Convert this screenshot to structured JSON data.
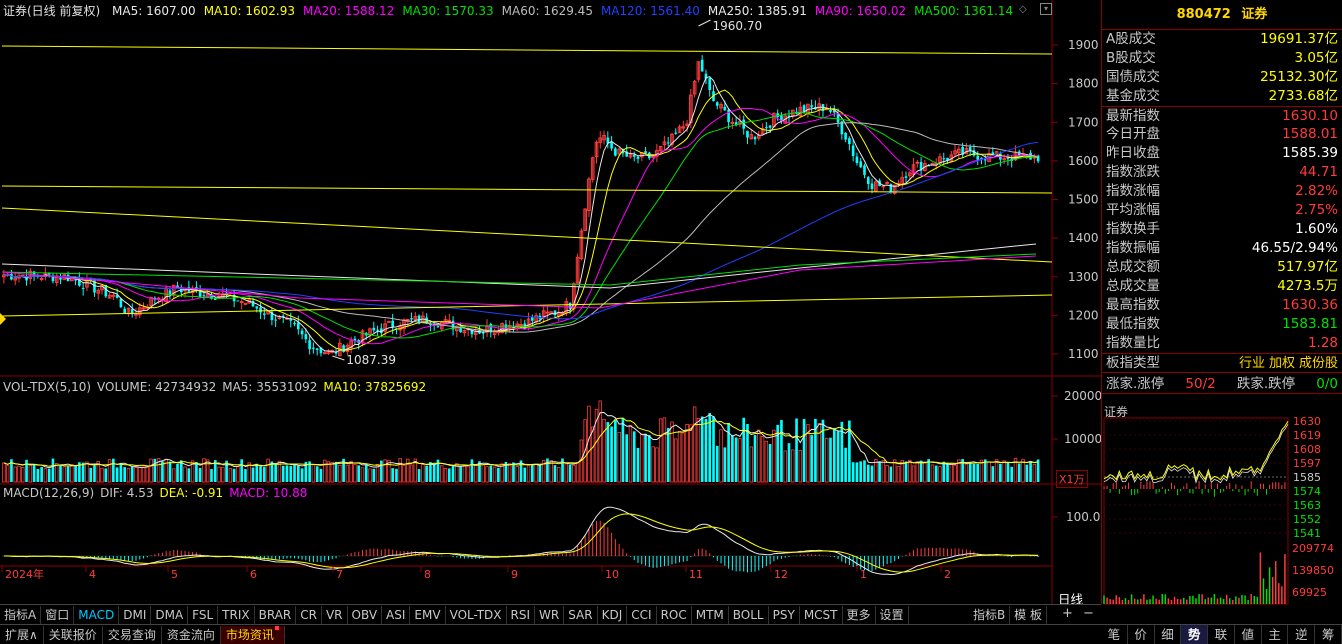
{
  "main_chart": {
    "title": "证券(日线 前复权)",
    "ma_legend": [
      {
        "label": "MA5: 1607.00",
        "color": "#e8e8e8"
      },
      {
        "label": "MA10: 1602.93",
        "color": "#ffff00"
      },
      {
        "label": "MA20: 1588.12",
        "color": "#ff00ff"
      },
      {
        "label": "MA30: 1570.33",
        "color": "#00e000"
      },
      {
        "label": "MA60: 1629.45",
        "color": "#bbbbbb"
      },
      {
        "label": "MA120: 1561.40",
        "color": "#2040ff"
      },
      {
        "label": "MA250: 1385.91",
        "color": "#e8e8e8"
      },
      {
        "label": "MA90: 1650.02",
        "color": "#ff00ff"
      },
      {
        "label": "MA500: 1361.14",
        "color": "#00e000"
      }
    ],
    "y_ticks": [
      "1900",
      "1800",
      "1700",
      "1600",
      "1500",
      "1400",
      "1300",
      "1200",
      "1100"
    ],
    "high_label": "1960.70",
    "low_label": "1087.39"
  },
  "volume_panel": {
    "legend": [
      {
        "label": "VOL-TDX(5,10)",
        "color": "#c8c8c8"
      },
      {
        "label": "VOLUME: 42734932",
        "color": "#c8c8c8"
      },
      {
        "label": "MA5: 35531092",
        "color": "#c8c8c8"
      },
      {
        "label": "MA10: 37825692",
        "color": "#ffff00"
      }
    ],
    "y_ticks": [
      "20000",
      "10000"
    ],
    "unit": "X1万"
  },
  "macd_panel": {
    "legend": [
      {
        "label": "MACD(12,26,9)",
        "color": "#c8c8c8"
      },
      {
        "label": "DIF: 4.53",
        "color": "#c8c8c8"
      },
      {
        "label": "DEA: -0.91",
        "color": "#ffff00"
      },
      {
        "label": "MACD: 10.88",
        "color": "#ff00ff"
      }
    ],
    "y_ticks": [
      "100.0"
    ]
  },
  "x_axis": [
    "2024年",
    "4",
    "5",
    "6",
    "7",
    "8",
    "9",
    "10",
    "11",
    "12",
    "1",
    "2"
  ],
  "info_panel": {
    "code": "880472",
    "name": "证券",
    "rows": [
      {
        "label": "A股成交",
        "value": "19691.37亿",
        "color": "yellow"
      },
      {
        "label": "B股成交",
        "value": "3.05亿",
        "color": "yellow"
      },
      {
        "label": "国债成交",
        "value": "25132.30亿",
        "color": "yellow"
      },
      {
        "label": "基金成交",
        "value": "2733.68亿",
        "color": "yellow"
      },
      {
        "label": "最新指数",
        "value": "1630.10",
        "color": "red"
      },
      {
        "label": "今日开盘",
        "value": "1588.01",
        "color": "red"
      },
      {
        "label": "昨日收盘",
        "value": "1585.39",
        "color": "white"
      },
      {
        "label": "指数涨跌",
        "value": "44.71",
        "color": "red"
      },
      {
        "label": "指数涨幅",
        "value": "2.82%",
        "color": "red"
      },
      {
        "label": "平均涨幅",
        "value": "2.75%",
        "color": "red"
      },
      {
        "label": "指数换手",
        "value": "1.60%",
        "color": "white"
      },
      {
        "label": "指数振幅",
        "value": "46.55/2.94%",
        "color": "white"
      },
      {
        "label": "总成交额",
        "value": "517.97亿",
        "color": "yellow"
      },
      {
        "label": "总成交量",
        "value": "4273.5万",
        "color": "yellow"
      },
      {
        "label": "最高指数",
        "value": "1630.36",
        "color": "red"
      },
      {
        "label": "最低指数",
        "value": "1583.81",
        "color": "green"
      },
      {
        "label": "指数量比",
        "value": "1.28",
        "color": "red"
      }
    ],
    "type_label": "板指类型",
    "type_tags": [
      "行业",
      "加权",
      "成份股"
    ],
    "up_label": "涨家.涨停",
    "up_value": "50/2",
    "down_label": "跌家.跌停",
    "down_value": "0/0"
  },
  "mini_chart": {
    "title": "证券",
    "price_ticks": [
      "1630",
      "1619",
      "1608",
      "1597",
      "1585",
      "1574",
      "1563",
      "1552",
      "1541"
    ],
    "vol_ticks": [
      "209774",
      "139850",
      "69925"
    ]
  },
  "indicator_tabs": [
    "指标A",
    "窗口",
    "MACD",
    "DMI",
    "DMA",
    "FSL",
    "TRIX",
    "BRAR",
    "CR",
    "VR",
    "OBV",
    "ASI",
    "EMV",
    "VOL-TDX",
    "RSI",
    "WR",
    "SAR",
    "KDJ",
    "CCI",
    "ROC",
    "MTM",
    "BOLL",
    "PSY",
    "MCST",
    "更多",
    "设置"
  ],
  "indicator_right": [
    "指标B",
    "模 板"
  ],
  "period_tab": "日线",
  "plus_minus": [
    "+",
    "−"
  ],
  "bottom_tabs": [
    "扩展∧",
    "关联报价",
    "交易查询",
    "资金流向",
    "市场资讯"
  ],
  "right_tabs": [
    "笔",
    "价",
    "细",
    "势",
    "联",
    "値",
    "主",
    "逆",
    "筹"
  ]
}
